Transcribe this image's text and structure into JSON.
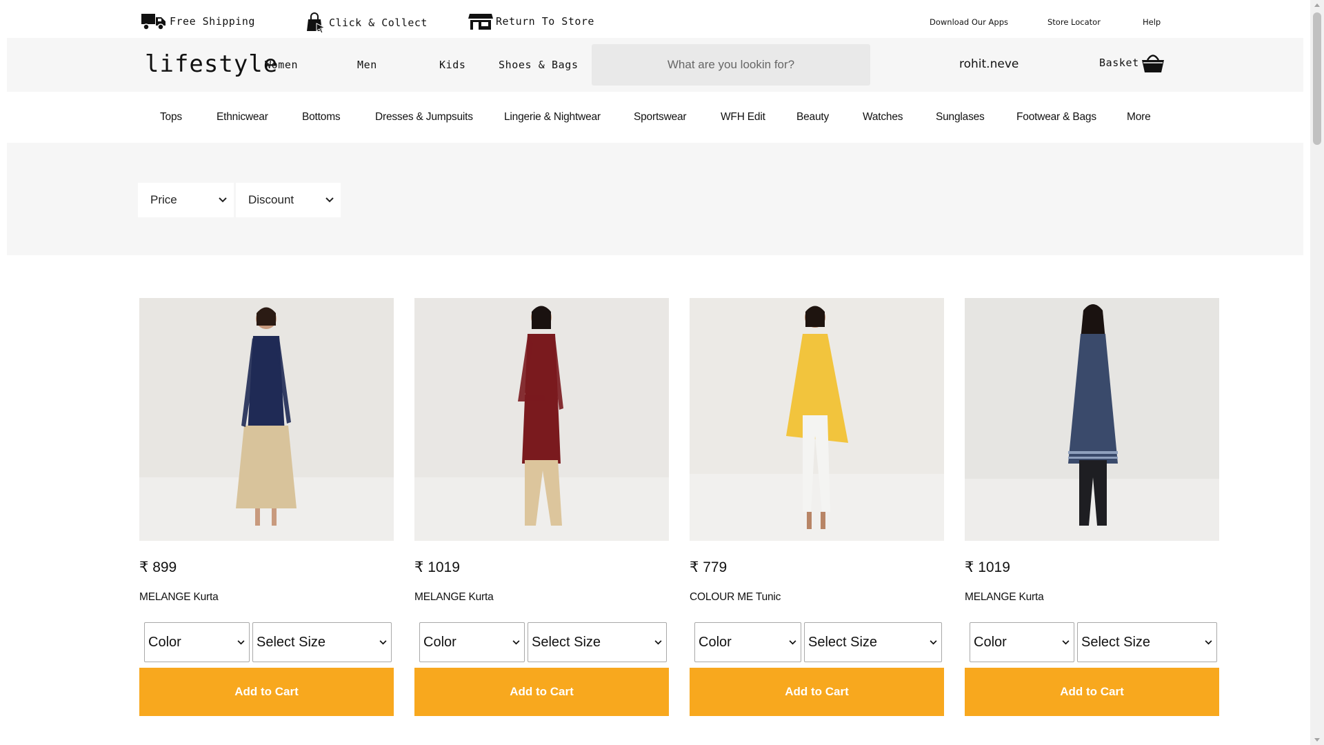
{
  "utility_bar": {
    "free_shipping": "Free Shipping",
    "click_collect": "Click & Collect",
    "return_to_store": "Return To Store",
    "download_apps": "Download Our Apps",
    "store_locator": "Store Locator",
    "help": "Help"
  },
  "header": {
    "logo": "lifestyle",
    "categories": [
      "Women",
      "Men",
      "Kids",
      "Shoes & Bags"
    ],
    "search_placeholder": "What are you lookin for?",
    "username": "rohit.neve",
    "basket_label": "Basket"
  },
  "sub_nav": [
    "Tops",
    "Ethnicwear",
    "Bottoms",
    "Dresses & Jumpsuits",
    "Lingerie & Nightwear",
    "Sportswear",
    "WFH Edit",
    "Beauty",
    "Watches",
    "Sunglases",
    "Footwear & Bags",
    "More"
  ],
  "filters": {
    "price": "Price",
    "discount": "Discount"
  },
  "products": [
    {
      "price": "₹ 899",
      "name": "MELANGE Kurta",
      "color_select": "Color",
      "size_select": "Select Size",
      "cart_button": "Add to Cart",
      "outfit_colors": {
        "top": "#1f2a55",
        "bottom": "#d8c39b"
      }
    },
    {
      "price": "₹ 1019",
      "name": "MELANGE Kurta",
      "color_select": "Color",
      "size_select": "Select Size",
      "cart_button": "Add to Cart",
      "outfit_colors": {
        "top": "#7a1a1e",
        "bottom": "#dcc59c"
      }
    },
    {
      "price": "₹ 779",
      "name": "COLOUR ME Tunic",
      "color_select": "Color",
      "size_select": "Select Size",
      "cart_button": "Add to Cart",
      "outfit_colors": {
        "top": "#f2c43d",
        "bottom": "#f4f4f2"
      }
    },
    {
      "price": "₹ 1019",
      "name": "MELANGE Kurta",
      "color_select": "Color",
      "size_select": "Select Size",
      "cart_button": "Add to Cart",
      "outfit_colors": {
        "top": "#3a4a6b",
        "bottom": "#1e1e22"
      }
    }
  ],
  "colors": {
    "accent": "#f8a81e",
    "header_bg": "#f6f6f6",
    "search_bg": "#e9e9e9"
  }
}
